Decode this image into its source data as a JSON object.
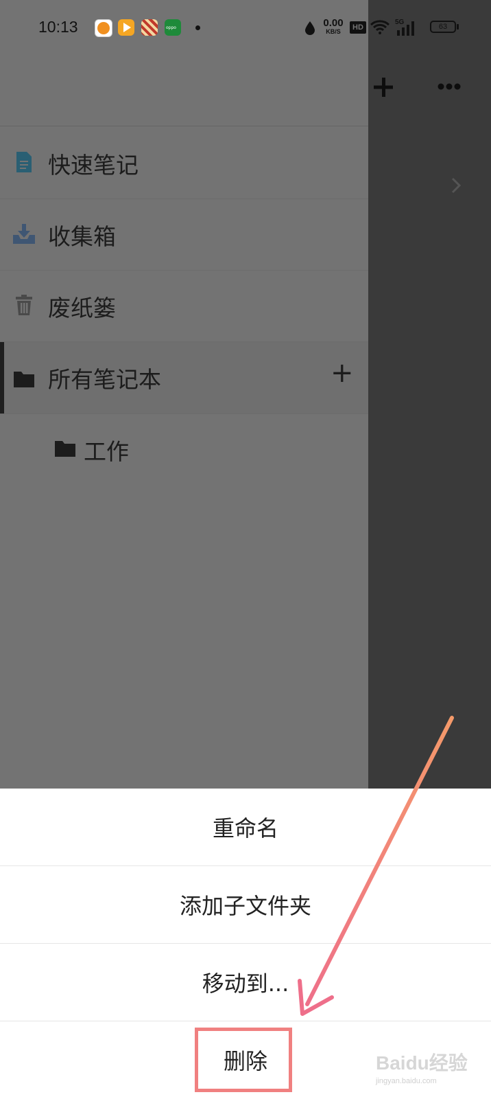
{
  "status_bar": {
    "time": "10:13",
    "net_speed": "0.00",
    "net_unit": "KB/S",
    "hd": "HD",
    "network": "5G",
    "battery": "63"
  },
  "toolbar": {
    "add_icon": "plus-icon",
    "more_icon": "more-icon"
  },
  "drawer": {
    "items": [
      {
        "label": "快速笔记",
        "icon": "note-icon",
        "icon_color": "#2a5f73"
      },
      {
        "label": "收集箱",
        "icon": "inbox-icon",
        "icon_color": "#3f5673"
      },
      {
        "label": "废纸篓",
        "icon": "trash-icon",
        "icon_color": "#4a4a4a"
      },
      {
        "label": "所有笔记本",
        "icon": "folder-icon",
        "icon_color": "#1c1c1c",
        "active": true,
        "action": "+"
      }
    ],
    "subitems": [
      {
        "label": "工作",
        "icon": "folder-icon"
      }
    ]
  },
  "action_sheet": {
    "items": [
      {
        "label": "重命名"
      },
      {
        "label": "添加子文件夹"
      },
      {
        "label": "移动到..."
      },
      {
        "label": "删除",
        "highlighted": true
      }
    ]
  },
  "watermark": {
    "text": "Baidu经验",
    "subtext": "jingyan.baidu.com"
  },
  "colors": {
    "accent_annotation": "#f08080",
    "drawer_bg": "#737373",
    "overlay_bg": "#3a3a3a"
  }
}
